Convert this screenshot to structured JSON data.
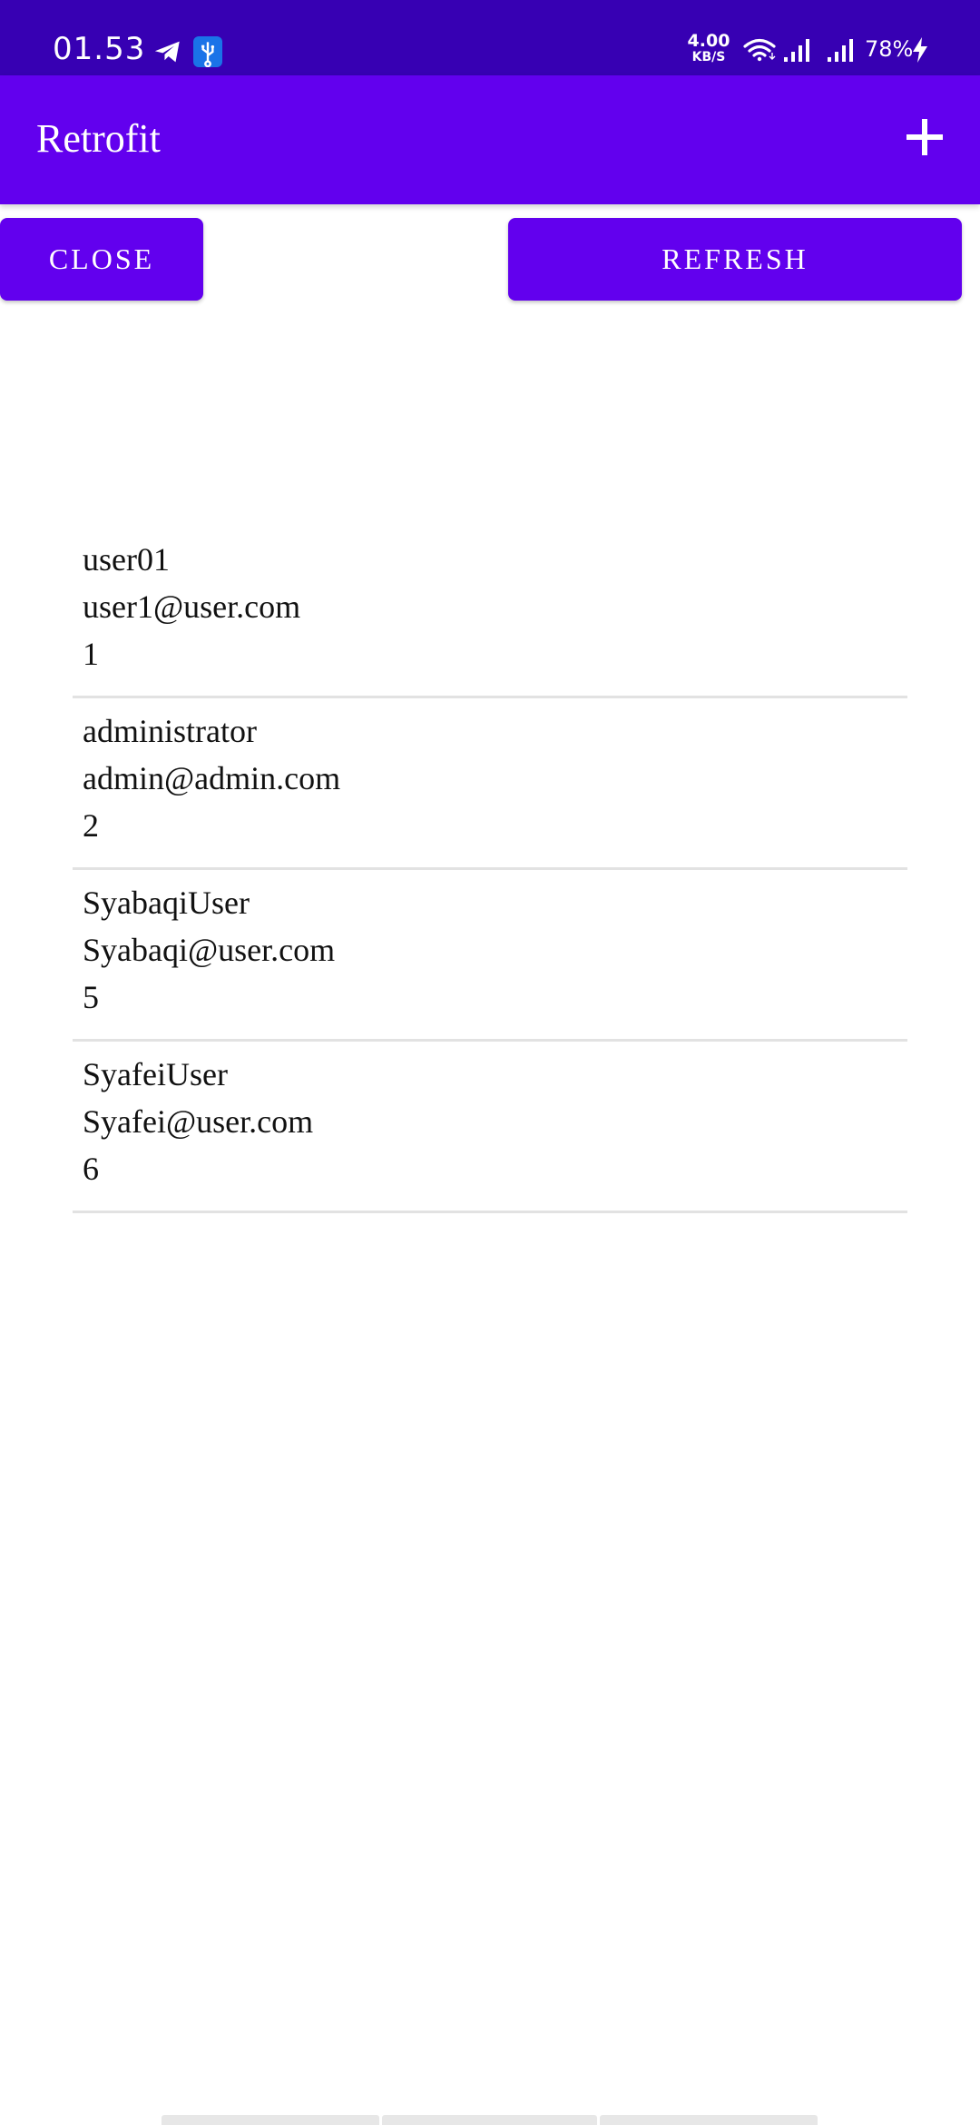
{
  "status_bar": {
    "time": "01.53",
    "net_speed_value": "4.00",
    "net_speed_unit": "KB/S",
    "battery": "78%",
    "icons": [
      "telegram-icon",
      "usb-icon",
      "wifi-icon",
      "signal-icon",
      "signal-icon",
      "charging-bolt-icon"
    ]
  },
  "app_bar": {
    "title": "Retrofit",
    "add_icon": "plus-icon"
  },
  "buttons": {
    "close_label": "CLOSE",
    "refresh_label": "REFRESH"
  },
  "colors": {
    "primary": "#6200EE",
    "primary_dark": "#3700B3",
    "text": "#111111",
    "divider": "#e2e2e2"
  },
  "users": [
    {
      "name": "user01",
      "email": "user1@user.com",
      "id": "1"
    },
    {
      "name": "administrator",
      "email": "admin@admin.com",
      "id": "2"
    },
    {
      "name": "SyabaqiUser",
      "email": "Syabaqi@user.com",
      "id": "5"
    },
    {
      "name": "SyafeiUser",
      "email": "Syafei@user.com",
      "id": "6"
    }
  ]
}
